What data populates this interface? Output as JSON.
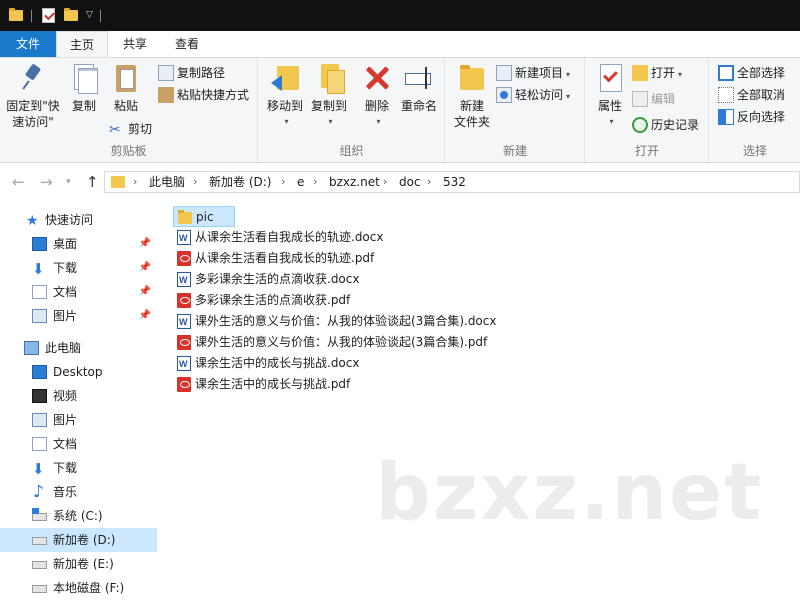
{
  "ribbon_tabs": {
    "file": "文件",
    "home": "主页",
    "share": "共享",
    "view": "查看"
  },
  "clipboard": {
    "pin": "固定到\"快\n速访问\"",
    "pin_line1": "固定到\"快",
    "pin_line2": "速访问\"",
    "copy": "复制",
    "paste": "粘贴",
    "copy_path": "复制路径",
    "paste_shortcut": "粘贴快捷方式",
    "cut": "剪切",
    "label": "剪贴板"
  },
  "organize": {
    "move_to": "移动到",
    "copy_to": "复制到",
    "delete": "删除",
    "rename": "重命名",
    "label": "组织"
  },
  "new": {
    "new_folder_line1": "新建",
    "new_folder_line2": "文件夹",
    "new_item": "新建项目",
    "easy_access": "轻松访问",
    "label": "新建"
  },
  "open": {
    "properties": "属性",
    "open": "打开",
    "edit": "编辑",
    "history": "历史记录",
    "label": "打开"
  },
  "select": {
    "select_all": "全部选择",
    "select_none": "全部取消",
    "invert": "反向选择",
    "label": "选择"
  },
  "breadcrumb": [
    "此电脑",
    "新加卷 (D:)",
    "e",
    "bzxz.net",
    "doc",
    "532"
  ],
  "nav": {
    "quick_access": "快速访问",
    "desktop_qa": "桌面",
    "downloads_qa": "下载",
    "documents_qa": "文档",
    "pictures_qa": "图片",
    "this_pc": "此电脑",
    "desktop": "Desktop",
    "videos": "视频",
    "pictures": "图片",
    "documents": "文档",
    "downloads": "下载",
    "music": "音乐",
    "drive_c": "系统 (C:)",
    "drive_d": "新加卷 (D:)",
    "drive_e": "新加卷 (E:)",
    "drive_f": "本地磁盘 (F:)"
  },
  "files": [
    {
      "name": "pic",
      "type": "folder"
    },
    {
      "name": "从课余生活看自我成长的轨迹.docx",
      "type": "docx"
    },
    {
      "name": "从课余生活看自我成长的轨迹.pdf",
      "type": "pdf"
    },
    {
      "name": "多彩课余生活的点滴收获.docx",
      "type": "docx"
    },
    {
      "name": "多彩课余生活的点滴收获.pdf",
      "type": "pdf"
    },
    {
      "name": "课外生活的意义与价值：从我的体验谈起(3篇合集).docx",
      "type": "docx"
    },
    {
      "name": "课外生活的意义与价值：从我的体验谈起(3篇合集).pdf",
      "type": "pdf"
    },
    {
      "name": "课余生活中的成长与挑战.docx",
      "type": "docx"
    },
    {
      "name": "课余生活中的成长与挑战.pdf",
      "type": "pdf"
    }
  ],
  "watermark": "bzxz.net",
  "colors": {
    "accent": "#1979ca",
    "selection": "#cce8ff",
    "folder": "#f3c64d",
    "pdf": "#d9322b"
  }
}
